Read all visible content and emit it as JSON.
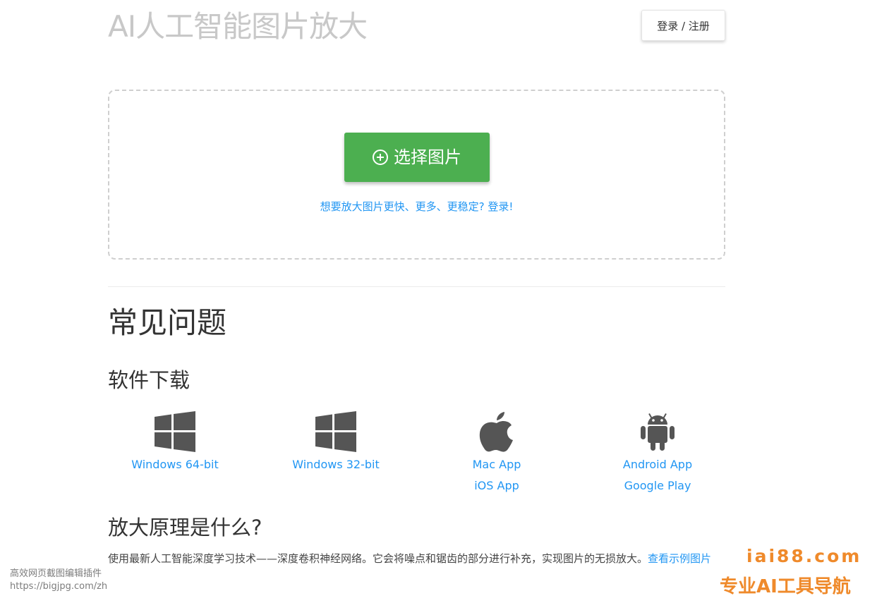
{
  "header": {
    "site_title": "AI人工智能图片放大",
    "login_label": "登录 / 注册"
  },
  "upload": {
    "button_icon": "plus-circle-icon",
    "button_label": "选择图片",
    "hint": "想要放大图片更快、更多、更稳定? 登录!"
  },
  "faq": {
    "title": "常见问题",
    "downloads_title": "软件下载",
    "downloads": [
      {
        "icon": "windows-icon",
        "links": [
          "Windows 64-bit"
        ]
      },
      {
        "icon": "windows-icon",
        "links": [
          "Windows 32-bit"
        ]
      },
      {
        "icon": "apple-icon",
        "links": [
          "Mac App",
          "iOS App"
        ]
      },
      {
        "icon": "android-icon",
        "links": [
          "Android App",
          "Google Play"
        ]
      }
    ],
    "principle_title": "放大原理是什么?",
    "principle_text": "使用最新人工智能深度学习技术——深度卷积神经网络。它会将噪点和锯齿的部分进行补充，实现图片的无损放大。",
    "principle_link": "查看示例图片"
  },
  "capture_note": {
    "line1": "高效网页截图编辑插件",
    "line2": "https://bigjpg.com/zh"
  },
  "watermark": {
    "domain": "iai88.com",
    "slogan": "专业AI工具导航"
  },
  "colors": {
    "accent_green": "#4caf50",
    "link_blue": "#2196f3",
    "watermark_orange": "#ef8a2b"
  }
}
